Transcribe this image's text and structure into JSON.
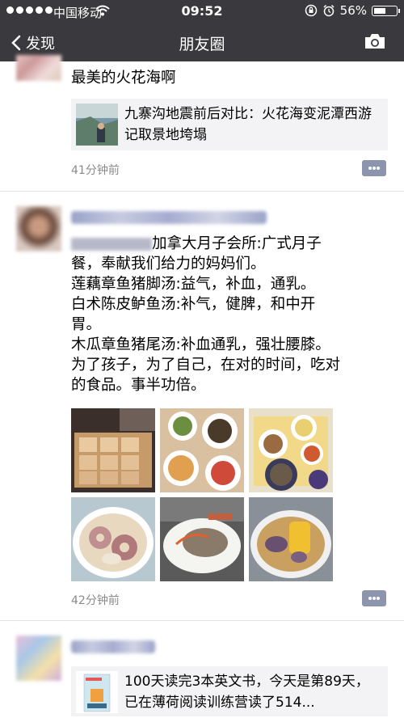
{
  "status": {
    "carrier": "中国移动",
    "time": "09:52",
    "battery": "56%",
    "battery_level": 0.56
  },
  "nav": {
    "back": "发现",
    "title": "朋友圈"
  },
  "post1": {
    "text": "最美的火花海啊",
    "share_title": "九寨沟地震前后对比：火花海变泥潭西游记取景地垮塌",
    "time": "41分钟前"
  },
  "post2": {
    "text_lines": [
      "加拿大月子会所:广式月子",
      "餐，奉献我们给力的妈妈们。",
      "莲藕章鱼猪脚汤:益气，补血，通乳。",
      "白术陈皮鲈鱼汤:补气，健脾，和中开",
      "胃。",
      "木瓜章鱼猪尾汤:补血通乳，强壮腰膝。",
      "为了孩子，为了自己，在对的时间，吃对",
      "的食品。事半功倍。"
    ],
    "time": "42分钟前"
  },
  "post3": {
    "share_title": "100天读完3本英文书，今天是第89天，已在薄荷阅读训练营读了514..."
  }
}
